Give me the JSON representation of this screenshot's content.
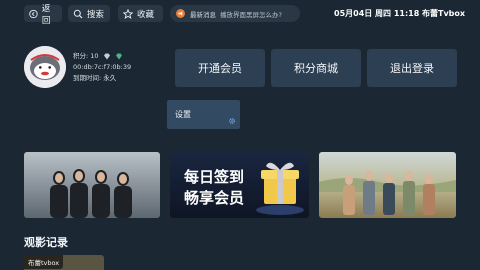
{
  "topbar": {
    "back_label": "返回",
    "search_label": "搜索",
    "favorites_label": "收藏",
    "news_label": "最新消息",
    "news_message": "播放界面黑屏怎么办?",
    "datetime": "05月04日 周四 11:18",
    "brand": "布蕾Tvbox"
  },
  "profile": {
    "points_label": "积分: 10",
    "mac": "00:db:7c:f7:0b:39",
    "expiry": "到期时间: 永久"
  },
  "actions": {
    "vip_label": "开通会员",
    "shop_label": "积分商城",
    "logout_label": "退出登录",
    "settings_label": "设置"
  },
  "banners": {
    "signin_line1": "每日签到",
    "signin_line2": "畅享会员"
  },
  "history": {
    "title": "观影记录",
    "items": [
      {
        "tag": "布蕾tvbox"
      }
    ]
  },
  "colors": {
    "background": "#1b2733",
    "button": "#2d3f52",
    "focused": "#324a62",
    "accent": "#e87d3a"
  }
}
